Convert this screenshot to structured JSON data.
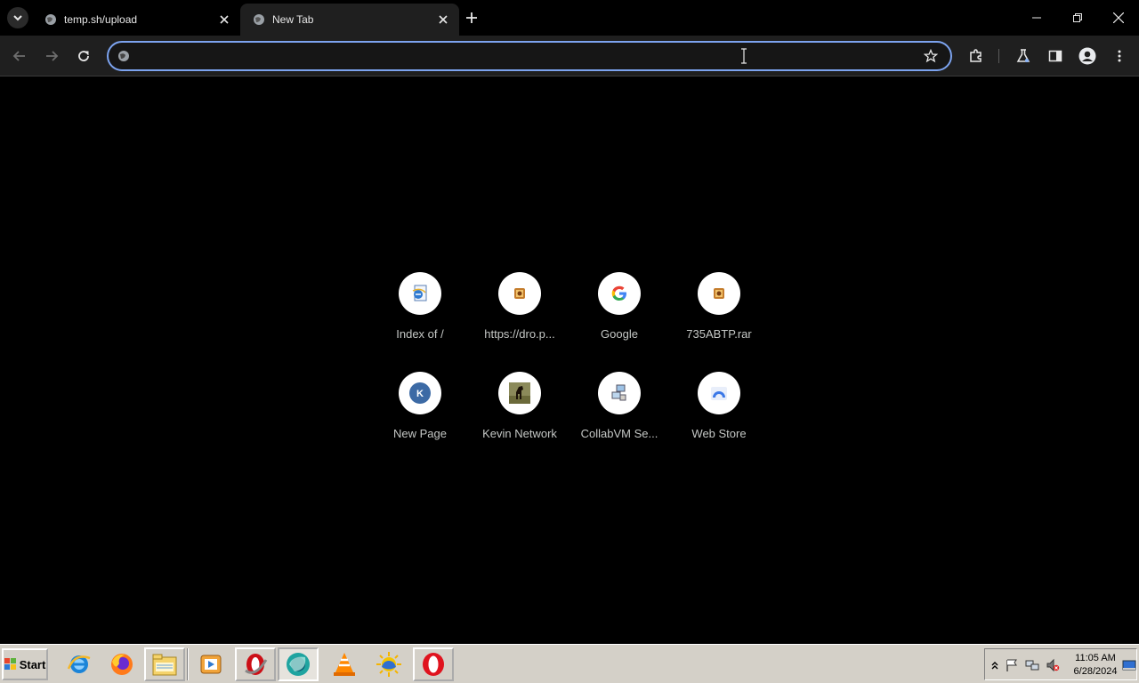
{
  "tabs": [
    {
      "title": "temp.sh/upload",
      "active": false
    },
    {
      "title": "New Tab",
      "active": true
    }
  ],
  "omnibox": {
    "value": "",
    "placeholder": ""
  },
  "shortcuts": [
    {
      "label": "Index of /",
      "icon": "ie-page-icon"
    },
    {
      "label": "https://dro.p...",
      "icon": "archive-icon"
    },
    {
      "label": "Google",
      "icon": "google-icon"
    },
    {
      "label": "735ABTP.rar",
      "icon": "archive-icon"
    },
    {
      "label": "New Page",
      "icon": "letter-k-icon",
      "letter": "K"
    },
    {
      "label": "Kevin Network",
      "icon": "horse-thumbnail-icon"
    },
    {
      "label": "CollabVM Se...",
      "icon": "network-computers-icon"
    },
    {
      "label": "Web Store",
      "icon": "web-store-icon"
    }
  ],
  "taskbar": {
    "start_label": "Start",
    "apps": [
      "internet-explorer-icon",
      "firefox-icon",
      "file-explorer-icon",
      "media-player-icon",
      "opera-old-icon",
      "chrome-icon",
      "vlc-icon",
      "weather-app-icon",
      "opera-icon"
    ],
    "clock_time": "11:05 AM",
    "clock_date": "6/28/2024"
  },
  "colors": {
    "omnibox_focus": "#7ca3ef",
    "page_bg": "#000000",
    "toolbar_bg": "#1f1f1f",
    "taskbar_bg": "#d4d0c8"
  }
}
